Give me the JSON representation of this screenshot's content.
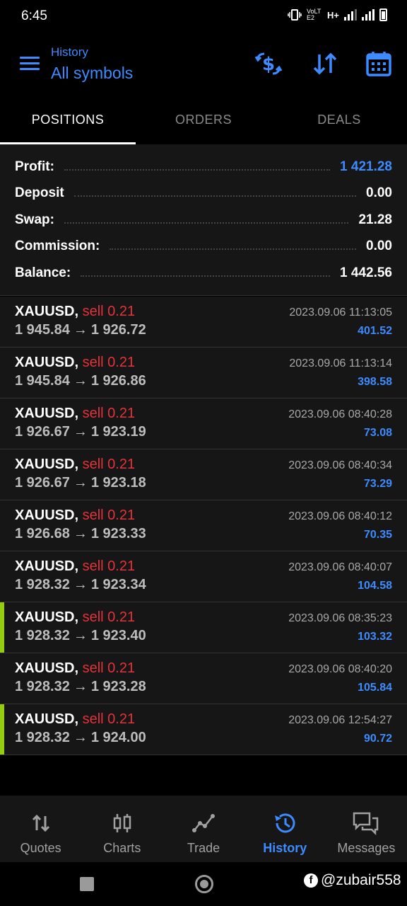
{
  "status": {
    "time": "6:45",
    "network": "H+",
    "volte": "VoLTE2"
  },
  "header": {
    "subtitle": "History",
    "title": "All symbols"
  },
  "tabs": [
    {
      "label": "POSITIONS",
      "active": true
    },
    {
      "label": "ORDERS",
      "active": false
    },
    {
      "label": "DEALS",
      "active": false
    }
  ],
  "summary": {
    "profit_label": "Profit:",
    "profit_value": "1 421.28",
    "deposit_label": "Deposit",
    "deposit_value": "0.00",
    "swap_label": "Swap:",
    "swap_value": "21.28",
    "commission_label": "Commission:",
    "commission_value": "0.00",
    "balance_label": "Balance:",
    "balance_value": "1 442.56"
  },
  "positions": [
    {
      "symbol": "XAUUSD,",
      "side": "sell 0.21",
      "open": "1 945.84",
      "arrow": "→",
      "close": "1 926.72",
      "date": "2023.09.06 11:13:05",
      "profit": "401.52",
      "marked": false
    },
    {
      "symbol": "XAUUSD,",
      "side": "sell 0.21",
      "open": "1 945.84",
      "arrow": "→",
      "close": "1 926.86",
      "date": "2023.09.06 11:13:14",
      "profit": "398.58",
      "marked": false
    },
    {
      "symbol": "XAUUSD,",
      "side": "sell 0.21",
      "open": "1 926.67",
      "arrow": "→",
      "close": "1 923.19",
      "date": "2023.09.06 08:40:28",
      "profit": "73.08",
      "marked": false
    },
    {
      "symbol": "XAUUSD,",
      "side": "sell 0.21",
      "open": "1 926.67",
      "arrow": "→",
      "close": "1 923.18",
      "date": "2023.09.06 08:40:34",
      "profit": "73.29",
      "marked": false
    },
    {
      "symbol": "XAUUSD,",
      "side": "sell 0.21",
      "open": "1 926.68",
      "arrow": "→",
      "close": "1 923.33",
      "date": "2023.09.06 08:40:12",
      "profit": "70.35",
      "marked": false
    },
    {
      "symbol": "XAUUSD,",
      "side": "sell 0.21",
      "open": "1 928.32",
      "arrow": "→",
      "close": "1 923.34",
      "date": "2023.09.06 08:40:07",
      "profit": "104.58",
      "marked": false
    },
    {
      "symbol": "XAUUSD,",
      "side": "sell 0.21",
      "open": "1 928.32",
      "arrow": "→",
      "close": "1 923.40",
      "date": "2023.09.06 08:35:23",
      "profit": "103.32",
      "marked": true
    },
    {
      "symbol": "XAUUSD,",
      "side": "sell 0.21",
      "open": "1 928.32",
      "arrow": "→",
      "close": "1 923.28",
      "date": "2023.09.06 08:40:20",
      "profit": "105.84",
      "marked": false
    },
    {
      "symbol": "XAUUSD,",
      "side": "sell 0.21",
      "open": "1 928.32",
      "arrow": "→",
      "close": "1 924.00",
      "date": "2023.09.06 12:54:27",
      "profit": "90.72",
      "marked": true
    }
  ],
  "bottom_nav": [
    {
      "label": "Quotes",
      "icon": "quotes-icon",
      "active": false
    },
    {
      "label": "Charts",
      "icon": "charts-icon",
      "active": false
    },
    {
      "label": "Trade",
      "icon": "trade-icon",
      "active": false
    },
    {
      "label": "History",
      "icon": "history-icon",
      "active": true
    },
    {
      "label": "Messages",
      "icon": "messages-icon",
      "active": false
    }
  ],
  "watermark": {
    "text": "@zubair558"
  },
  "colors": {
    "accent": "#3d8bff",
    "sell": "#e5323a",
    "marker": "#94cc12",
    "background": "#161616"
  }
}
